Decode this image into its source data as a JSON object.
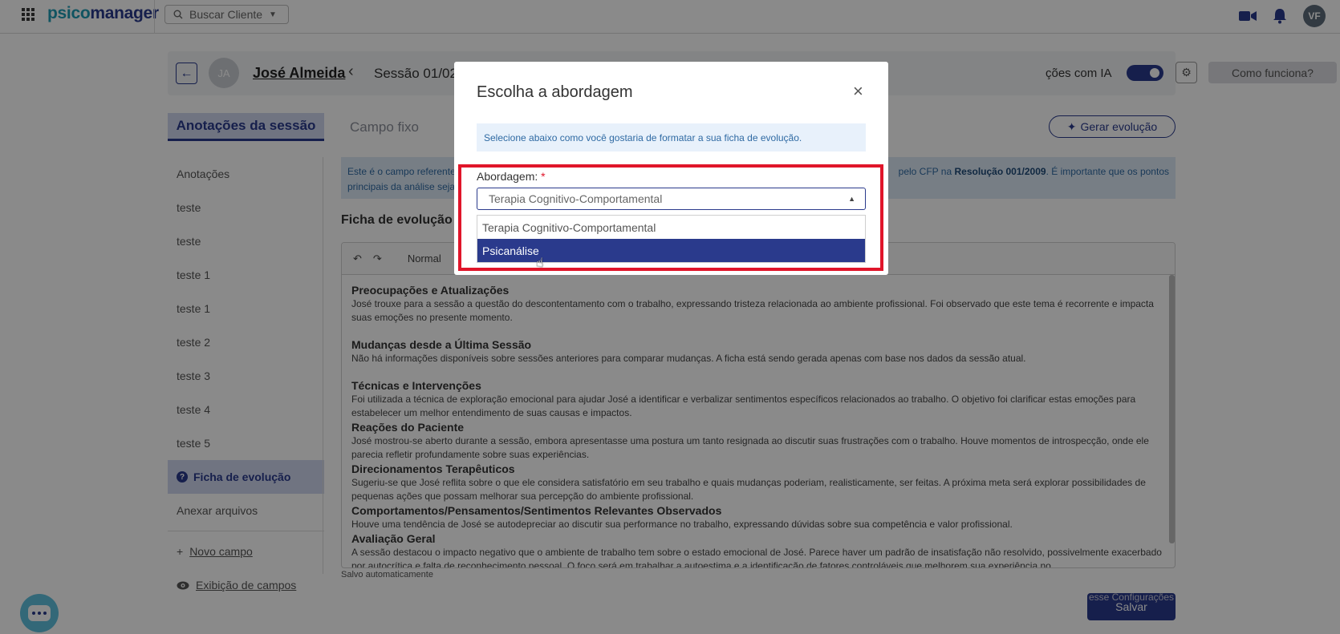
{
  "topbar": {
    "logo_part1": "psico",
    "logo_part2": "manager",
    "search_label": "Buscar Cliente",
    "user_initials": "VF"
  },
  "header": {
    "patient_initials": "JA",
    "patient_name": "José Almeida",
    "session_label": "Sessão 01/02/",
    "ai_label": "ções com IA",
    "how_button": "Como funciona?"
  },
  "tabs": {
    "active": "Anotações da sessão",
    "inactive": "Campo fixo",
    "generate_button": "Gerar evolução"
  },
  "sidebar": {
    "items": [
      {
        "label": "Anotações"
      },
      {
        "label": "teste"
      },
      {
        "label": "teste"
      },
      {
        "label": "teste 1"
      },
      {
        "label": "teste 1"
      },
      {
        "label": "teste 2"
      },
      {
        "label": "teste 3"
      },
      {
        "label": "teste 4"
      },
      {
        "label": "teste 5"
      }
    ],
    "active_item": "Ficha de evolução",
    "attach": "Anexar arquivos",
    "new_field": "Novo campo",
    "display_fields": "Exibição de campos"
  },
  "info": {
    "text_left": "Este é o campo referente",
    "text_right_pre": "pelo CFP na",
    "resolution": "Resolução 001/2009",
    "text_right_post": ". É importante que os pontos",
    "text_line2": "principais da análise seja"
  },
  "ficha": {
    "title": "Ficha de evolução",
    "format": "Normal",
    "sections": [
      {
        "heading": "Preocupações e Atualizações",
        "body": "José trouxe para a sessão a questão do descontentamento com o trabalho, expressando tristeza relacionada ao ambiente profissional. Foi observado que este tema é recorrente e impacta suas emoções no presente momento."
      },
      {
        "heading": "Mudanças desde a Última Sessão",
        "body": "Não há informações disponíveis sobre sessões anteriores para comparar mudanças. A ficha está sendo gerada apenas com base nos dados da sessão atual."
      },
      {
        "heading": "Técnicas e Intervenções",
        "body": "Foi utilizada a técnica de exploração emocional para ajudar José a identificar e verbalizar sentimentos específicos relacionados ao trabalho. O objetivo foi clarificar estas emoções para estabelecer um melhor entendimento de suas causas e impactos."
      },
      {
        "heading": "Reações do Paciente",
        "body": "José mostrou-se aberto durante a sessão, embora apresentasse uma postura um tanto resignada ao discutir suas frustrações com o trabalho. Houve momentos de introspecção, onde ele parecia refletir profundamente sobre suas experiências."
      },
      {
        "heading": "Direcionamentos Terapêuticos",
        "body": "Sugeriu-se que José reflita sobre o que ele considera satisfatório em seu trabalho e quais mudanças poderiam, realisticamente, ser feitas. A próxima meta será explorar possibilidades de pequenas ações que possam melhorar sua percepção do ambiente profissional."
      },
      {
        "heading": "Comportamentos/Pensamentos/Sentimentos Relevantes Observados",
        "body": "Houve uma tendência de José se autodepreciar ao discutir sua performance no trabalho, expressando dúvidas sobre sua competência e valor profissional."
      },
      {
        "heading": "Avaliação Geral",
        "body": "A sessão destacou o impacto negativo que o ambiente de trabalho tem sobre o estado emocional de José. Parece haver um padrão de insatisfação não resolvido, possivelmente exacerbado por autocrítica e falta de reconhecimento pessoal. O foco será em trabalhar a autoestima e a identificação de fatores controláveis que melhorem sua experiência no"
      }
    ],
    "autosave": "Salvo automaticamente"
  },
  "footer": {
    "save_button": "Salvar",
    "tooltip": "esse Configurações"
  },
  "modal": {
    "title": "Escolha a abordagem",
    "hint": "Selecione abaixo como você gostaria de formatar a sua ficha de evolução.",
    "field_label": "Abordagem:",
    "required_mark": "*",
    "selected_value": "Terapia Cognitivo-Comportamental",
    "options": [
      {
        "label": "Terapia Cognitivo-Comportamental"
      },
      {
        "label": "Psicanálise"
      }
    ]
  },
  "colors": {
    "brand": "#2a3a8c",
    "brand_light": "#1e9bb4",
    "highlight_frame": "#e0152a"
  }
}
